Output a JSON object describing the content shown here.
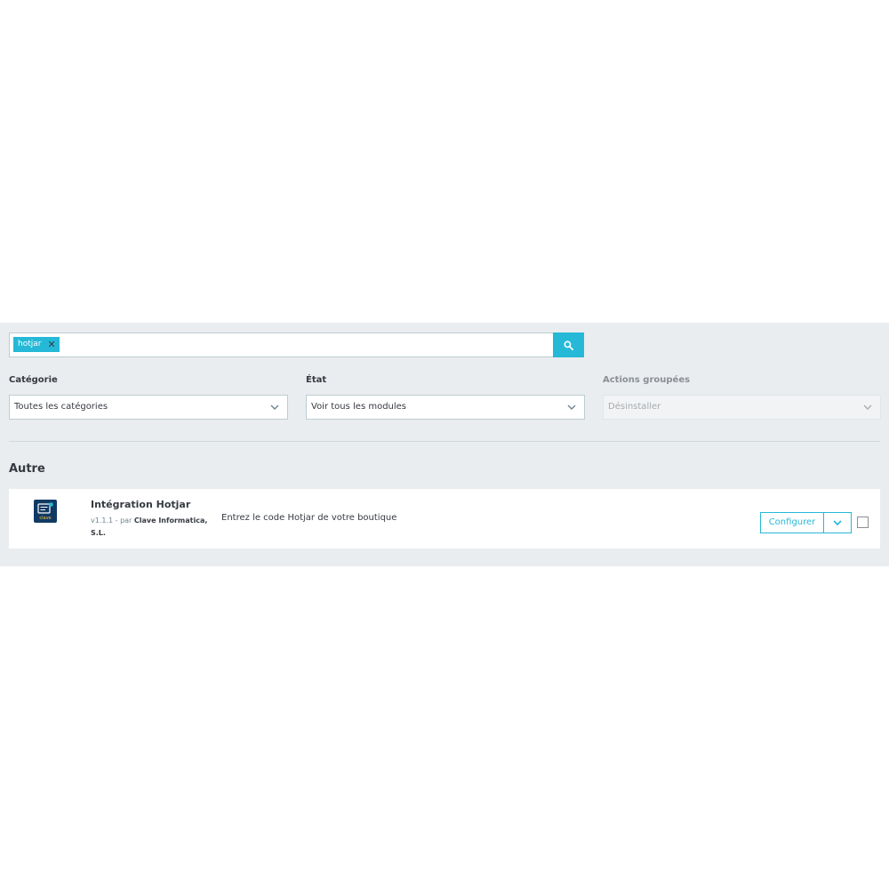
{
  "search": {
    "tag_label": "hotjar",
    "tag_remove_glyph": "✕",
    "icon": "search-icon"
  },
  "filters": {
    "category": {
      "label": "Catégorie",
      "value": "Toutes les catégories"
    },
    "state": {
      "label": "État",
      "value": "Voir tous les modules"
    },
    "bulk_actions": {
      "label": "Actions groupées",
      "value": "Désinstaller"
    }
  },
  "section": {
    "title": "Autre"
  },
  "module": {
    "name": "Intégration Hotjar",
    "version": "v1.1.1",
    "by": " - par ",
    "author": "Clave Informatica, S.L.",
    "description": "Entrez le code Hotjar de votre boutique",
    "logo_text": "clave",
    "configure_label": "Configurer"
  },
  "colors": {
    "accent": "#25b9d7",
    "panel_bg": "#eaedef",
    "text": "#363a41",
    "logo_bg": "#113a63"
  }
}
